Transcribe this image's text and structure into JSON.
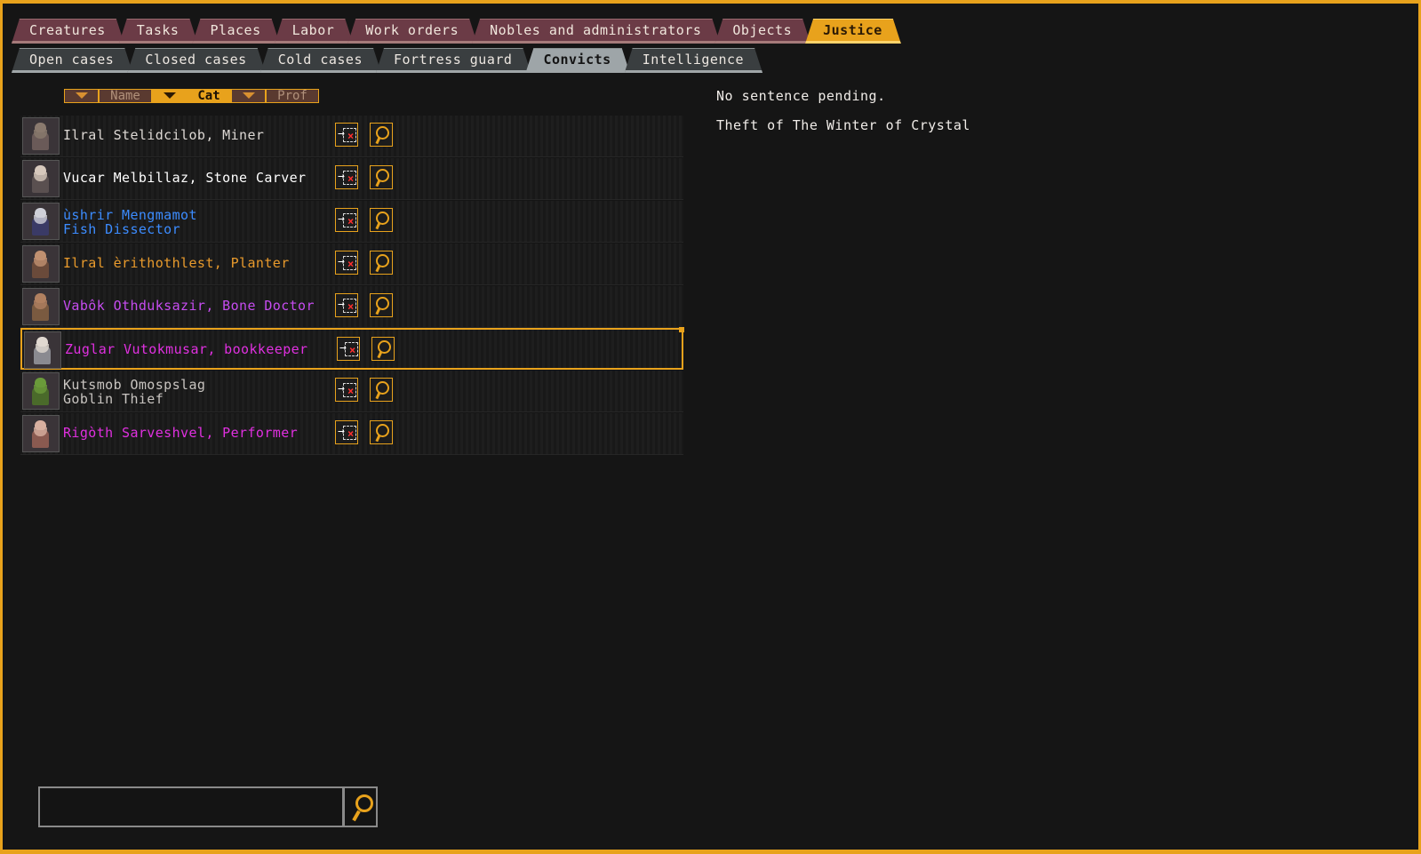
{
  "main_tabs": [
    {
      "label": "Creatures",
      "active": false
    },
    {
      "label": "Tasks",
      "active": false
    },
    {
      "label": "Places",
      "active": false
    },
    {
      "label": "Labor",
      "active": false
    },
    {
      "label": "Work orders",
      "active": false
    },
    {
      "label": "Nobles and administrators",
      "active": false
    },
    {
      "label": "Objects",
      "active": false
    },
    {
      "label": "Justice",
      "active": true
    }
  ],
  "sub_tabs": [
    {
      "label": "Open cases",
      "active": false
    },
    {
      "label": "Closed cases",
      "active": false
    },
    {
      "label": "Cold cases",
      "active": false
    },
    {
      "label": "Fortress guard",
      "active": false
    },
    {
      "label": "Convicts",
      "active": true
    },
    {
      "label": "Intelligence",
      "active": false
    }
  ],
  "sort": {
    "name_label": "Name",
    "cat_label": "Cat",
    "prof_label": "Prof",
    "active": "Cat"
  },
  "convicts": [
    {
      "line1": "Ilral Stelidcilob, Miner",
      "line2": "",
      "color": "white"
    },
    {
      "line1": "Vucar Melbillaz, Stone Carver",
      "line2": "",
      "color": "bright"
    },
    {
      "line1": "ùshrir Mengmamot",
      "line2": "Fish Dissector",
      "color": "blue"
    },
    {
      "line1": "Ilral èrithothlest, Planter",
      "line2": "",
      "color": "orange"
    },
    {
      "line1": "Vabôk Othduksazir, Bone Doctor",
      "line2": "",
      "color": "purple"
    },
    {
      "line1": "Zuglar Vutokmusar, bookkeeper",
      "line2": "",
      "color": "magenta",
      "selected": true
    },
    {
      "line1": "Kutsmob Omospslag",
      "line2": "Goblin Thief",
      "color": "gray"
    },
    {
      "line1": "Rigòth Sarveshvel, Performer",
      "line2": "",
      "color": "magenta"
    }
  ],
  "info": {
    "sentence": "No sentence pending.",
    "crime": "Theft of The Winter of Crystal"
  },
  "search": {
    "value": "",
    "placeholder": ""
  },
  "colors": {
    "accent": "#e8a21c",
    "background": "#151515"
  }
}
